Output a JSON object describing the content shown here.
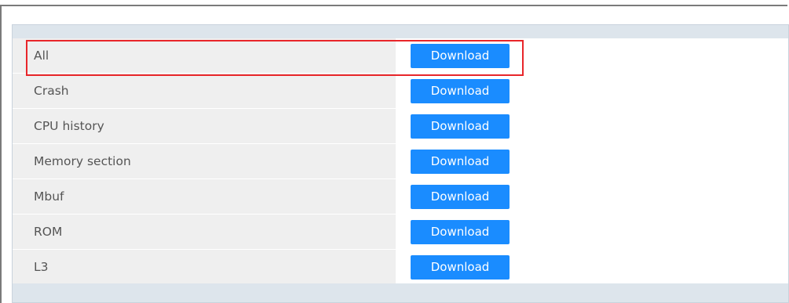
{
  "rows": [
    {
      "label": "All",
      "button_label": "Download"
    },
    {
      "label": "Crash",
      "button_label": "Download"
    },
    {
      "label": "CPU history",
      "button_label": "Download"
    },
    {
      "label": "Memory section",
      "button_label": "Download"
    },
    {
      "label": "Mbuf",
      "button_label": "Download"
    },
    {
      "label": "ROM",
      "button_label": "Download"
    },
    {
      "label": "L3",
      "button_label": "Download"
    }
  ],
  "colors": {
    "button_bg": "#1a8cff",
    "highlight": "#e8262a",
    "label_bg": "#efefef",
    "header_bg": "#dde5ec"
  },
  "highlighted_row_index": 0
}
